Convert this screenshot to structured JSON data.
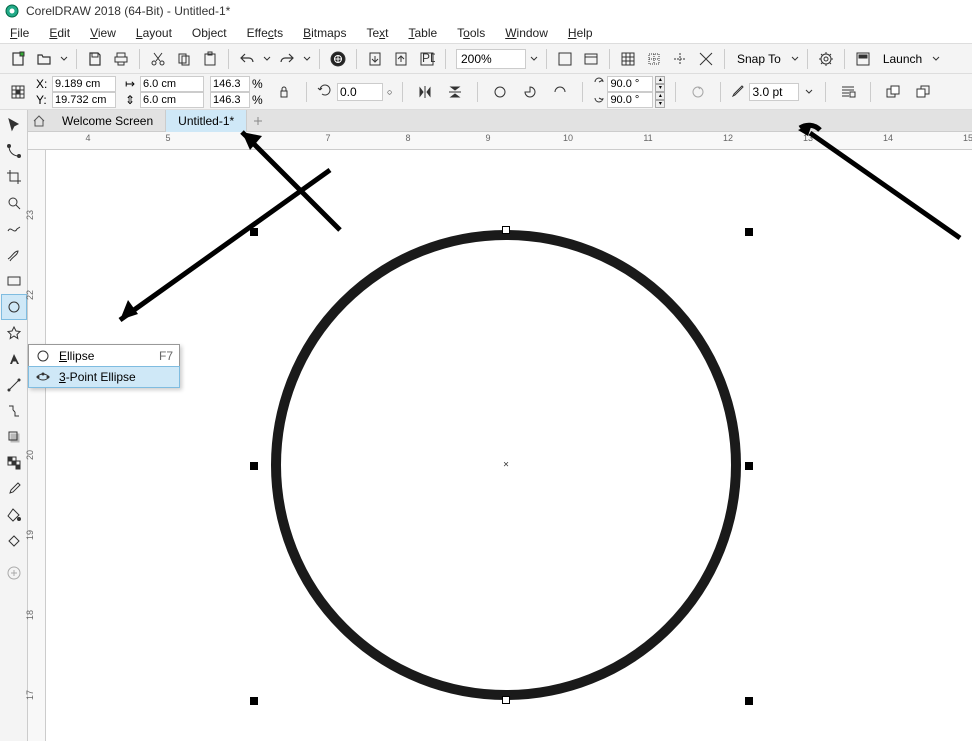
{
  "titlebar": {
    "text": "CorelDRAW 2018 (64-Bit) - Untitled-1*"
  },
  "menu": {
    "file": "File",
    "edit": "Edit",
    "view": "View",
    "layout": "Layout",
    "object": "Object",
    "effects": "Effects",
    "bitmaps": "Bitmaps",
    "text": "Text",
    "table": "Table",
    "tools": "Tools",
    "window": "Window",
    "help": "Help"
  },
  "toolbar": {
    "zoom": "200%",
    "snap": "Snap To",
    "launch": "Launch"
  },
  "propbar": {
    "x_label": "X:",
    "y_label": "Y:",
    "x": "9.189 cm",
    "y": "19.732 cm",
    "w": "6.0 cm",
    "h": "6.0 cm",
    "sx": "146.3",
    "sy": "146.3",
    "pct": "%",
    "rot": "0.0",
    "ang1": "90.0 °",
    "ang2": "90.0 °",
    "outline": "3.0 pt"
  },
  "tabs": {
    "welcome": "Welcome Screen",
    "doc": "Untitled-1*"
  },
  "flyout": {
    "ellipse": "Ellipse",
    "ellipse_key": "F7",
    "three_point": "3-Point Ellipse"
  },
  "ruler_h": [
    "4",
    "5",
    "6",
    "7",
    "8",
    "9",
    "10",
    "11",
    "12",
    "13",
    "14",
    "15"
  ],
  "ruler_v": [
    "23",
    "22",
    "20",
    "19",
    "18",
    "17"
  ]
}
